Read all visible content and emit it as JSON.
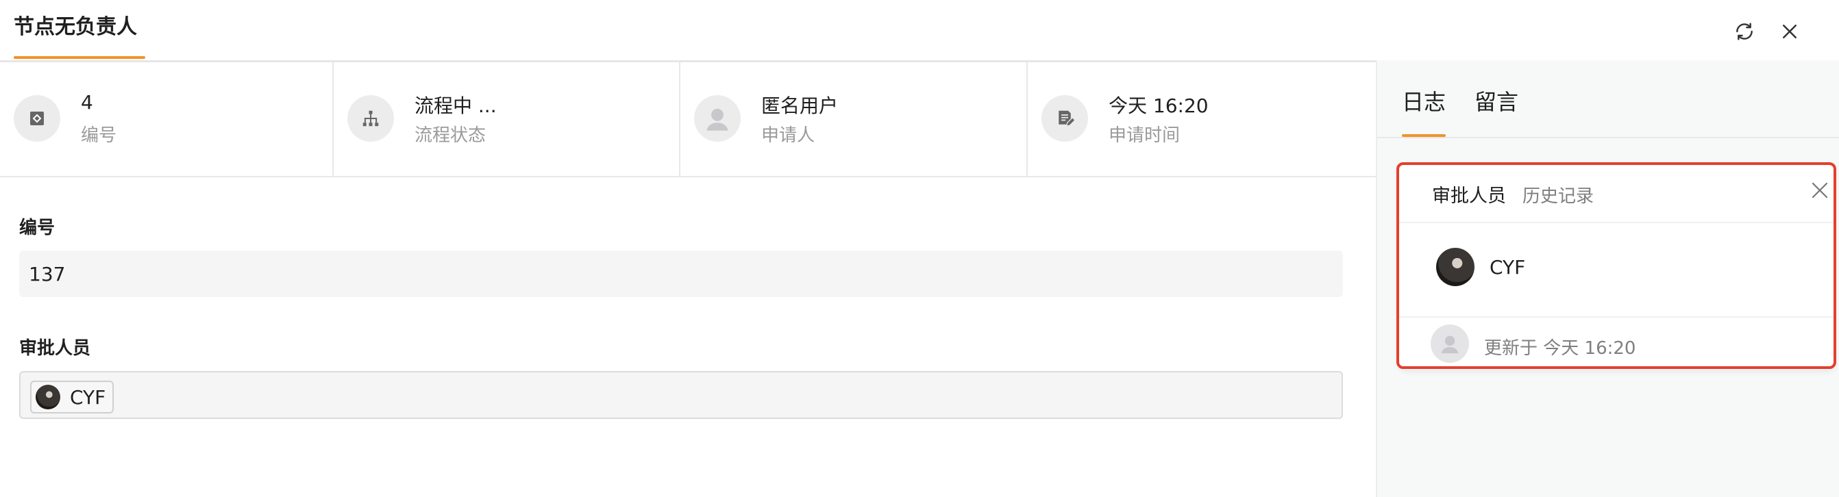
{
  "header": {
    "title": "节点无负责人",
    "icons": {
      "refresh": "refresh-icon",
      "close": "close-icon"
    },
    "accent_color": "#f0932b"
  },
  "info": [
    {
      "value": "4",
      "label": "编号",
      "icon": "id-icon"
    },
    {
      "value": "流程中 ...",
      "label": "流程状态",
      "icon": "flow-icon"
    },
    {
      "value": "匿名用户",
      "label": "申请人",
      "icon": "user-avatar-icon"
    },
    {
      "value": "今天 16:20",
      "label": "申请时间",
      "icon": "edit-document-icon"
    }
  ],
  "form": {
    "number_label": "编号",
    "number_value": "137",
    "approver_label": "审批人员",
    "approver_tag": "CYF"
  },
  "right_panel": {
    "tabs": [
      "日志",
      "留言"
    ],
    "active_tab": "日志",
    "popup": {
      "title": "审批人员",
      "history_link": "历史记录",
      "user_name": "CYF",
      "update_text": "更新于 今天 16:20",
      "highlight_color": "#e2402e"
    }
  }
}
